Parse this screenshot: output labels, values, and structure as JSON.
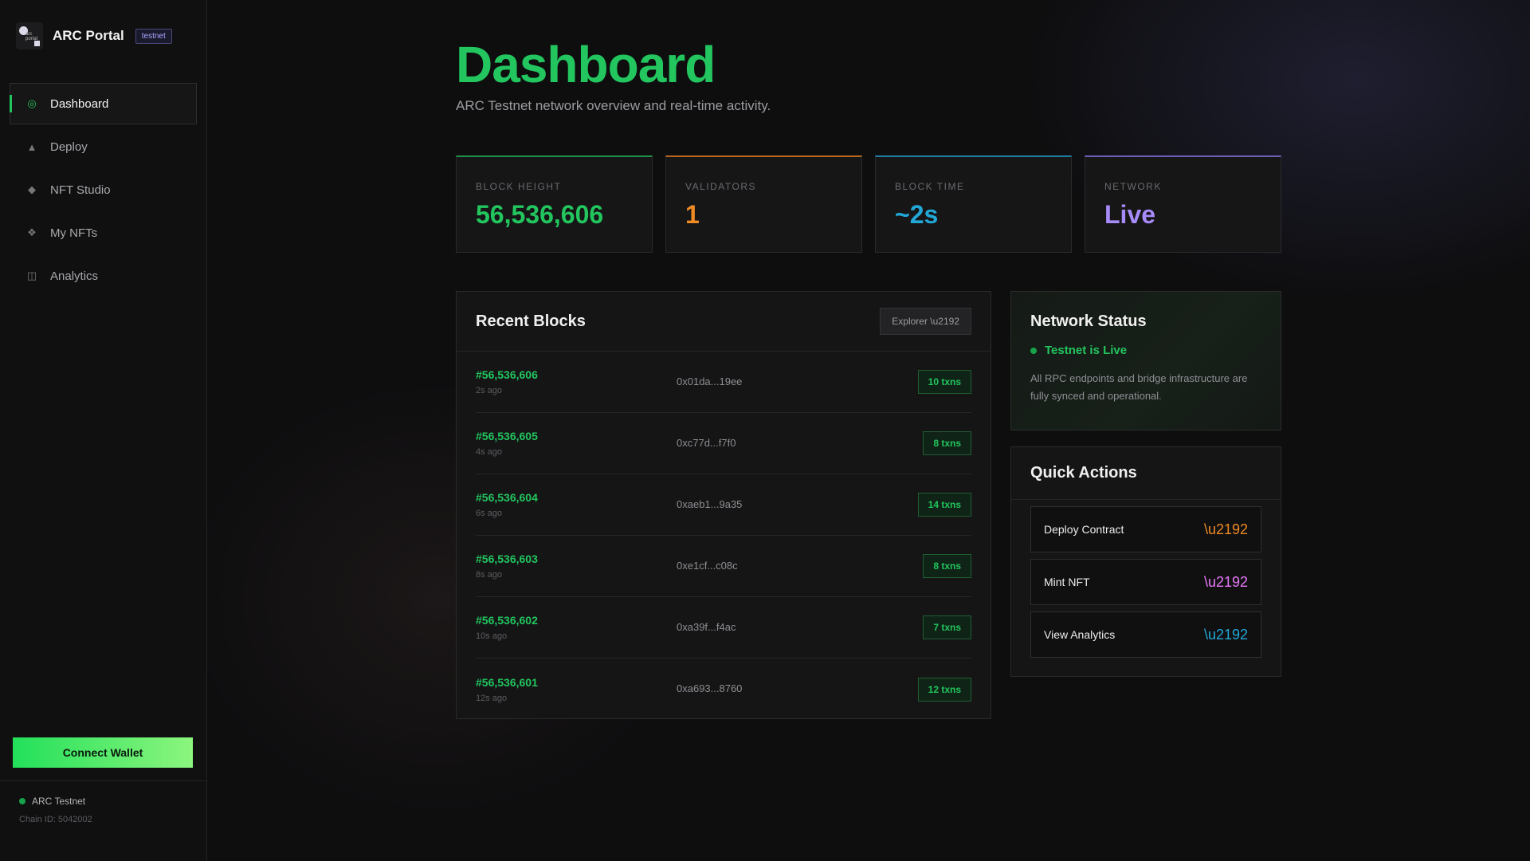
{
  "brand": {
    "name": "ARC Portal",
    "badge": "testnet",
    "logo_text": "arc portal"
  },
  "nav": [
    {
      "icon": "◎",
      "label": "Dashboard"
    },
    {
      "icon": "▲",
      "label": "Deploy"
    },
    {
      "icon": "◆",
      "label": "NFT Studio"
    },
    {
      "icon": "❖",
      "label": "My NFTs"
    },
    {
      "icon": "◫",
      "label": "Analytics"
    }
  ],
  "sidebar": {
    "connect_label": "Connect Wallet",
    "network_name": "ARC Testnet",
    "chain_id": "Chain ID: 5042002"
  },
  "header": {
    "title": "Dashboard",
    "subtitle": "ARC Testnet network overview and real-time activity."
  },
  "stats": [
    {
      "label": "BLOCK HEIGHT",
      "value": "56,536,606",
      "color": "#22c55e"
    },
    {
      "label": "VALIDATORS",
      "value": "1",
      "color": "#f08a24"
    },
    {
      "label": "BLOCK TIME",
      "value": "~2s",
      "color": "#22a8d8"
    },
    {
      "label": "NETWORK",
      "value": "Live",
      "color": "#a78bfa"
    }
  ],
  "recent_blocks": {
    "title": "Recent Blocks",
    "explorer_label": "Explorer \\u2192",
    "rows": [
      {
        "number": "#56,536,606",
        "age": "2s ago",
        "hash": "0x01da...19ee",
        "txns": "10 txns"
      },
      {
        "number": "#56,536,605",
        "age": "4s ago",
        "hash": "0xc77d...f7f0",
        "txns": "8 txns"
      },
      {
        "number": "#56,536,604",
        "age": "6s ago",
        "hash": "0xaeb1...9a35",
        "txns": "14 txns"
      },
      {
        "number": "#56,536,603",
        "age": "8s ago",
        "hash": "0xe1cf...c08c",
        "txns": "8 txns"
      },
      {
        "number": "#56,536,602",
        "age": "10s ago",
        "hash": "0xa39f...f4ac",
        "txns": "7 txns"
      },
      {
        "number": "#56,536,601",
        "age": "12s ago",
        "hash": "0xa693...8760",
        "txns": "12 txns"
      }
    ]
  },
  "network_status": {
    "title": "Network Status",
    "status": "Testnet is Live",
    "description": "All RPC endpoints and bridge infrastructure are fully synced and operational."
  },
  "quick_actions": {
    "title": "Quick Actions",
    "items": [
      {
        "label": "Deploy Contract",
        "arrow": "\\u2192",
        "color": "#f08a24"
      },
      {
        "label": "Mint NFT",
        "arrow": "\\u2192",
        "color": "#e879f9"
      },
      {
        "label": "View Analytics",
        "arrow": "\\u2192",
        "color": "#22a8d8"
      }
    ]
  }
}
